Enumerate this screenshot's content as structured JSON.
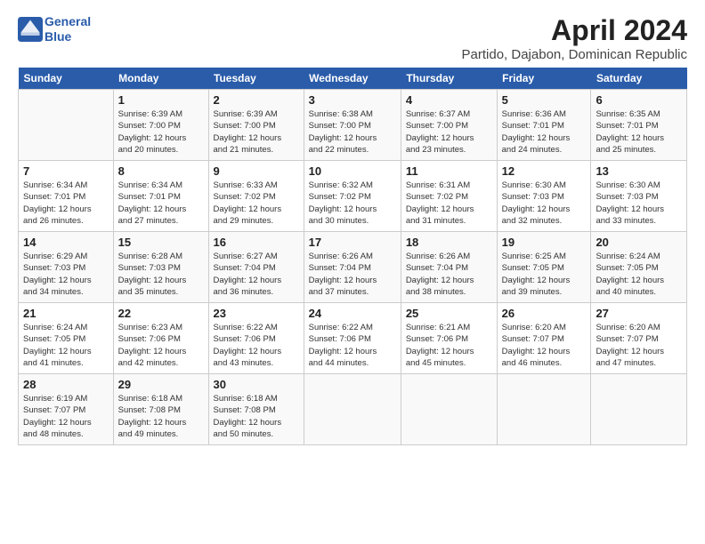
{
  "header": {
    "logo_line1": "General",
    "logo_line2": "Blue",
    "month_title": "April 2024",
    "subtitle": "Partido, Dajabon, Dominican Republic"
  },
  "days_of_week": [
    "Sunday",
    "Monday",
    "Tuesday",
    "Wednesday",
    "Thursday",
    "Friday",
    "Saturday"
  ],
  "weeks": [
    [
      {
        "day": "",
        "info": ""
      },
      {
        "day": "1",
        "info": "Sunrise: 6:39 AM\nSunset: 7:00 PM\nDaylight: 12 hours\nand 20 minutes."
      },
      {
        "day": "2",
        "info": "Sunrise: 6:39 AM\nSunset: 7:00 PM\nDaylight: 12 hours\nand 21 minutes."
      },
      {
        "day": "3",
        "info": "Sunrise: 6:38 AM\nSunset: 7:00 PM\nDaylight: 12 hours\nand 22 minutes."
      },
      {
        "day": "4",
        "info": "Sunrise: 6:37 AM\nSunset: 7:00 PM\nDaylight: 12 hours\nand 23 minutes."
      },
      {
        "day": "5",
        "info": "Sunrise: 6:36 AM\nSunset: 7:01 PM\nDaylight: 12 hours\nand 24 minutes."
      },
      {
        "day": "6",
        "info": "Sunrise: 6:35 AM\nSunset: 7:01 PM\nDaylight: 12 hours\nand 25 minutes."
      }
    ],
    [
      {
        "day": "7",
        "info": "Sunrise: 6:34 AM\nSunset: 7:01 PM\nDaylight: 12 hours\nand 26 minutes."
      },
      {
        "day": "8",
        "info": "Sunrise: 6:34 AM\nSunset: 7:01 PM\nDaylight: 12 hours\nand 27 minutes."
      },
      {
        "day": "9",
        "info": "Sunrise: 6:33 AM\nSunset: 7:02 PM\nDaylight: 12 hours\nand 29 minutes."
      },
      {
        "day": "10",
        "info": "Sunrise: 6:32 AM\nSunset: 7:02 PM\nDaylight: 12 hours\nand 30 minutes."
      },
      {
        "day": "11",
        "info": "Sunrise: 6:31 AM\nSunset: 7:02 PM\nDaylight: 12 hours\nand 31 minutes."
      },
      {
        "day": "12",
        "info": "Sunrise: 6:30 AM\nSunset: 7:03 PM\nDaylight: 12 hours\nand 32 minutes."
      },
      {
        "day": "13",
        "info": "Sunrise: 6:30 AM\nSunset: 7:03 PM\nDaylight: 12 hours\nand 33 minutes."
      }
    ],
    [
      {
        "day": "14",
        "info": "Sunrise: 6:29 AM\nSunset: 7:03 PM\nDaylight: 12 hours\nand 34 minutes."
      },
      {
        "day": "15",
        "info": "Sunrise: 6:28 AM\nSunset: 7:03 PM\nDaylight: 12 hours\nand 35 minutes."
      },
      {
        "day": "16",
        "info": "Sunrise: 6:27 AM\nSunset: 7:04 PM\nDaylight: 12 hours\nand 36 minutes."
      },
      {
        "day": "17",
        "info": "Sunrise: 6:26 AM\nSunset: 7:04 PM\nDaylight: 12 hours\nand 37 minutes."
      },
      {
        "day": "18",
        "info": "Sunrise: 6:26 AM\nSunset: 7:04 PM\nDaylight: 12 hours\nand 38 minutes."
      },
      {
        "day": "19",
        "info": "Sunrise: 6:25 AM\nSunset: 7:05 PM\nDaylight: 12 hours\nand 39 minutes."
      },
      {
        "day": "20",
        "info": "Sunrise: 6:24 AM\nSunset: 7:05 PM\nDaylight: 12 hours\nand 40 minutes."
      }
    ],
    [
      {
        "day": "21",
        "info": "Sunrise: 6:24 AM\nSunset: 7:05 PM\nDaylight: 12 hours\nand 41 minutes."
      },
      {
        "day": "22",
        "info": "Sunrise: 6:23 AM\nSunset: 7:06 PM\nDaylight: 12 hours\nand 42 minutes."
      },
      {
        "day": "23",
        "info": "Sunrise: 6:22 AM\nSunset: 7:06 PM\nDaylight: 12 hours\nand 43 minutes."
      },
      {
        "day": "24",
        "info": "Sunrise: 6:22 AM\nSunset: 7:06 PM\nDaylight: 12 hours\nand 44 minutes."
      },
      {
        "day": "25",
        "info": "Sunrise: 6:21 AM\nSunset: 7:06 PM\nDaylight: 12 hours\nand 45 minutes."
      },
      {
        "day": "26",
        "info": "Sunrise: 6:20 AM\nSunset: 7:07 PM\nDaylight: 12 hours\nand 46 minutes."
      },
      {
        "day": "27",
        "info": "Sunrise: 6:20 AM\nSunset: 7:07 PM\nDaylight: 12 hours\nand 47 minutes."
      }
    ],
    [
      {
        "day": "28",
        "info": "Sunrise: 6:19 AM\nSunset: 7:07 PM\nDaylight: 12 hours\nand 48 minutes."
      },
      {
        "day": "29",
        "info": "Sunrise: 6:18 AM\nSunset: 7:08 PM\nDaylight: 12 hours\nand 49 minutes."
      },
      {
        "day": "30",
        "info": "Sunrise: 6:18 AM\nSunset: 7:08 PM\nDaylight: 12 hours\nand 50 minutes."
      },
      {
        "day": "",
        "info": ""
      },
      {
        "day": "",
        "info": ""
      },
      {
        "day": "",
        "info": ""
      },
      {
        "day": "",
        "info": ""
      }
    ]
  ]
}
